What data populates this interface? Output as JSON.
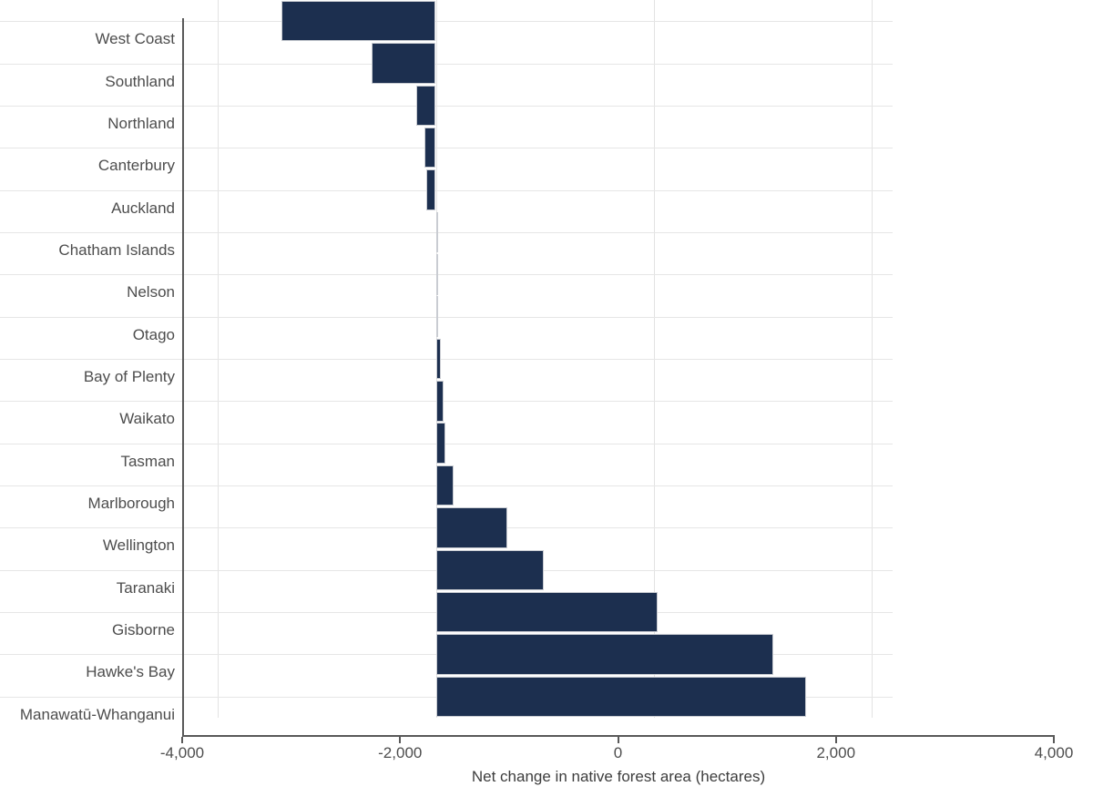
{
  "chart_data": {
    "type": "bar",
    "orientation": "horizontal",
    "title": "",
    "subtitle": "",
    "xlabel": "Net change in native forest area (hectares)",
    "ylabel": "",
    "xlim": [
      -4000,
      4000
    ],
    "xticks": [
      -4000,
      -2000,
      0,
      2000,
      4000
    ],
    "xtick_labels": [
      "-4,000",
      "-2,000",
      "0",
      "2,000",
      "4,000"
    ],
    "grid": true,
    "grid_axis": "both",
    "legend": null,
    "bar_color": "#1c2f4f",
    "bar_edge_color": "#c9ccd2",
    "background_color": "#ffffff",
    "categories": [
      "West Coast",
      "Southland",
      "Northland",
      "Canterbury",
      "Auckland",
      "Chatham Islands",
      "Nelson",
      "Otago",
      "Bay of Plenty",
      "Waikato",
      "Tasman",
      "Marlborough",
      "Wellington",
      "Taranaki",
      "Gisborne",
      "Hawke's Bay",
      "Manawatū-Whanganui"
    ],
    "values": [
      -1420,
      -593,
      -177,
      -101,
      -84,
      0,
      0,
      4,
      42,
      67,
      84,
      159,
      660,
      994,
      2038,
      3094,
      3394
    ]
  }
}
